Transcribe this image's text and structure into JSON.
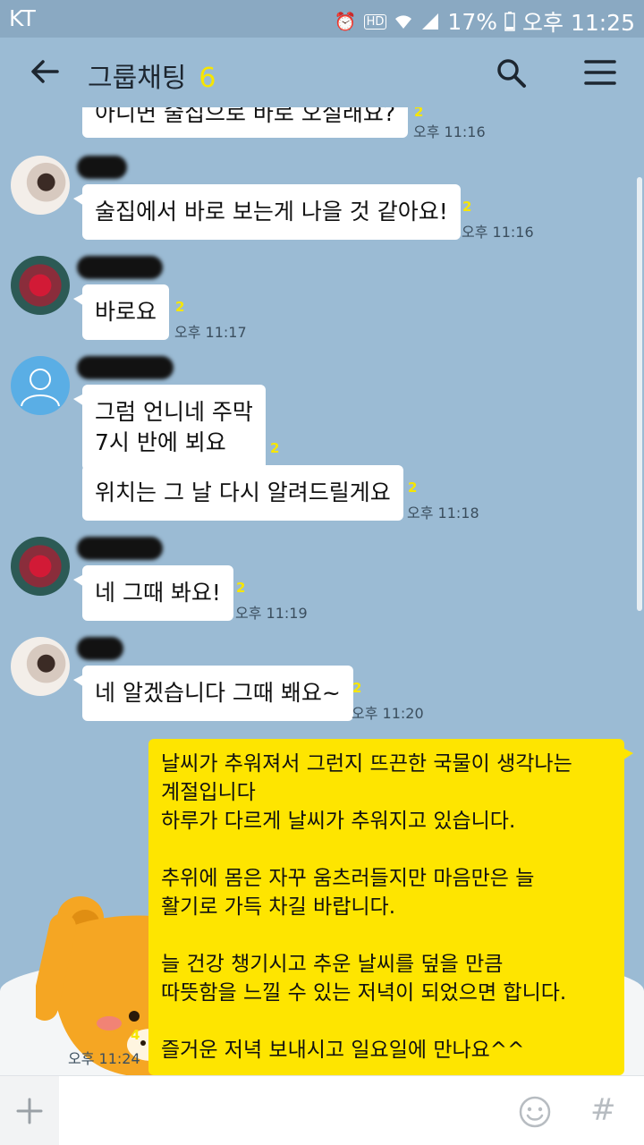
{
  "status_bar": {
    "carrier": "KT",
    "icons": [
      "alarm-icon",
      "hd-icon",
      "wifi-icon",
      "signal-icon"
    ],
    "battery": "17%",
    "time": "오후 11:25"
  },
  "header": {
    "title": "그룹채팅",
    "member_count": "6",
    "back_icon": "back-arrow-icon",
    "search_icon": "search-icon",
    "menu_icon": "menu-icon"
  },
  "messages": [
    {
      "text": "아니면 술집으로 바로 오실래요?",
      "unread": "2",
      "time": "오후 11:16"
    },
    {
      "text": "술집에서 바로 보는게 나을 것 같아요!",
      "unread": "2",
      "time": "오후 11:16"
    },
    {
      "text": "바로요",
      "unread": "2",
      "time": "오후 11:17"
    },
    {
      "text": "그럼 언니네 주막\n7시 반에 뵈요",
      "unread": "2"
    },
    {
      "text": "위치는 그 날 다시 알려드릴게요",
      "unread": "2",
      "time": "오후 11:18"
    },
    {
      "text": "네 그때 봐요!",
      "unread": "2",
      "time": "오후 11:19"
    },
    {
      "text": "네 알겠습니다 그때 봬요~",
      "unread": "2",
      "time": "오후 11:20"
    }
  ],
  "my_message": {
    "text": "날씨가 추워져서 그런지 뜨끈한 국물이 생각나는\n계절입니다\n하루가 다르게 날씨가 추워지고 있습니다.\n\n추위에 몸은 자꾸 움츠러들지만 마음만은 늘\n활기로 가득 차길 바랍니다.\n\n늘 건강 챙기시고 추운 날씨를 덮을 만큼\n따뜻함을 느낄 수 있는 저녁이 되었으면 합니다.\n\n즐거운 저녁 보내시고 일요일에 만나요^^",
    "unread": "4",
    "time": "오후 11:24"
  },
  "input_bar": {
    "placeholder": "",
    "plus_icon": "plus-icon",
    "emoji_icon": "emoji-icon",
    "hash_symbol": "#"
  },
  "colors": {
    "background": "#9bbbd4",
    "my_bubble": "#fee500",
    "unread": "#f7e600"
  }
}
